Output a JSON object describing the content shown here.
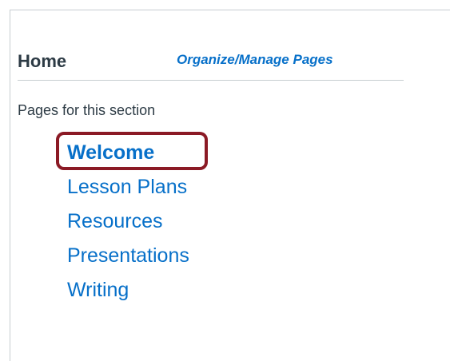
{
  "header": {
    "title": "Home",
    "organize_link": "Organize/Manage Pages"
  },
  "section": {
    "label": "Pages for this section"
  },
  "pages": [
    {
      "label": "Welcome",
      "active": true
    },
    {
      "label": "Lesson Plans",
      "active": false
    },
    {
      "label": "Resources",
      "active": false
    },
    {
      "label": "Presentations",
      "active": false
    },
    {
      "label": "Writing",
      "active": false
    }
  ],
  "colors": {
    "link": "#0770c9",
    "text": "#2d3b45",
    "highlight": "#8b1a25",
    "border": "#c7cdd1"
  }
}
